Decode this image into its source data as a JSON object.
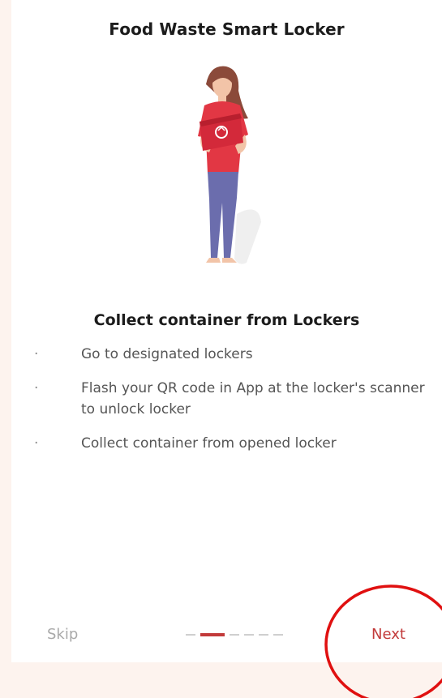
{
  "header": {
    "title": "Food Waste Smart Locker"
  },
  "illustration": {
    "icon": "woman-holding-recycling-box-illustration",
    "box_color": "#e23744",
    "shirt_color": "#e23744",
    "pants_color": "#6b6dad"
  },
  "content": {
    "heading": "Collect container from Lockers",
    "bullet_glyph": "·",
    "steps": [
      {
        "text": "Go to designated lockers"
      },
      {
        "text": "Flash your QR code in App at the locker's scanner to unlock locker"
      },
      {
        "text": "Collect container from opened locker"
      }
    ]
  },
  "footer": {
    "skip_label": "Skip",
    "next_label": "Next",
    "pager": {
      "total": 6,
      "current": 2
    }
  },
  "colors": {
    "accent": "#c23a3a",
    "annotation_circle": "#e01010"
  }
}
